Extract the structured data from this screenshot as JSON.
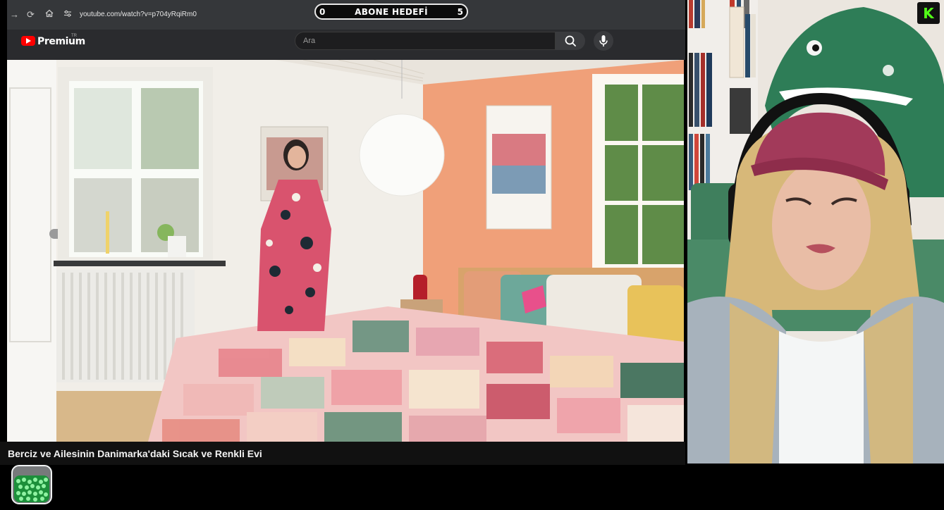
{
  "browser": {
    "url": "youtube.com/watch?v=p704yRqiRm0",
    "nav_icons": [
      "arrow-right-icon",
      "reload-icon",
      "home-icon",
      "site-info-icon"
    ]
  },
  "sub_goal": {
    "current": "0",
    "title": "ABONE HEDEFİ",
    "target": "5"
  },
  "youtube": {
    "wordmark": "Premium",
    "region": "TR",
    "search": {
      "placeholder": "Ara",
      "value": ""
    },
    "icons": [
      "youtube-logo-icon",
      "search-icon",
      "microphone-icon"
    ]
  },
  "video": {
    "title": "Berciz ve Ailesinin Danimarka'daki Sıcak ve Renkli Evi"
  },
  "overlay": {
    "kick_badge": "K",
    "colors": {
      "kick_green": "#53fc18",
      "yt_red": "#ff0000"
    }
  }
}
